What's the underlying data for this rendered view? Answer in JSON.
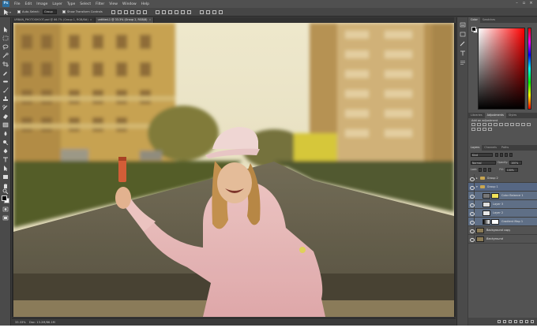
{
  "menubar": {
    "logo": "Ps",
    "items": [
      "File",
      "Edit",
      "Image",
      "Layer",
      "Type",
      "Select",
      "Filter",
      "View",
      "Window",
      "Help"
    ],
    "workspace": "Essentials",
    "window_controls": [
      "–",
      "▫",
      "×"
    ]
  },
  "options": {
    "auto_select_label": "Auto-Select:",
    "auto_select_value": "Group",
    "show_transform_label": "Show Transform Controls"
  },
  "tabs": [
    {
      "label": "URBAN_PHOTOSHOOT.psd @ 66.7% (Group 1, RGB/8#)",
      "active": false
    },
    {
      "label": "untitled-1 @ 33.3% (Group 2, RGB/8)",
      "active": true
    }
  ],
  "status": {
    "zoom": "33.33%",
    "doc_size": "Doc: 13.2M/86.1M"
  },
  "panels": {
    "color_tabs": [
      "Color",
      "Swatches"
    ],
    "adj_tabs": [
      "Libraries",
      "Adjustments",
      "Styles"
    ],
    "adj_title": "Add an adjustment",
    "layers_tabs": [
      "Layers",
      "Channels",
      "Paths"
    ],
    "kind_label": "Kind",
    "blend_mode": "Normal",
    "opacity_label": "Opacity:",
    "opacity_value": "100%",
    "lock_label": "Lock:",
    "fill_label": "Fill:",
    "fill_value": "100%",
    "layers": [
      {
        "name": "Group 2",
        "type": "group"
      },
      {
        "name": "Group 1",
        "type": "group"
      },
      {
        "name": "Color Balance 1",
        "type": "adjustment"
      },
      {
        "name": "Layer 3",
        "type": "layer"
      },
      {
        "name": "Layer 2",
        "type": "layer"
      },
      {
        "name": "Gradient Map 1",
        "type": "adjustment"
      },
      {
        "name": "Background copy",
        "type": "layer"
      },
      {
        "name": "Background",
        "type": "layer"
      }
    ]
  },
  "colors": {
    "app_bg": "#3c3c3c",
    "panel_bg": "#535353",
    "selection": "#5f6f86",
    "accent": "#2d6f9f"
  }
}
